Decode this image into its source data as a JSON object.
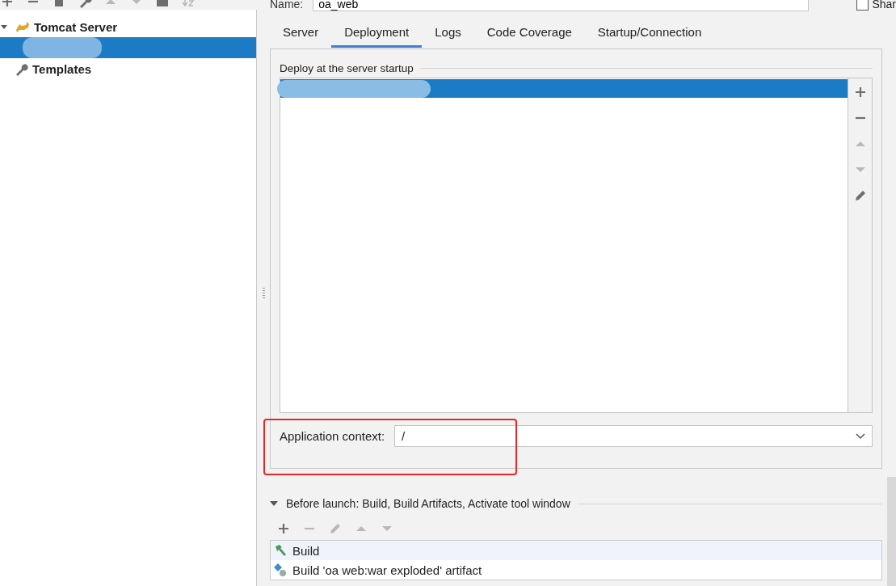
{
  "tree": [
    {
      "kind": "server",
      "label": "Tomcat Server",
      "expanded": true,
      "selected": false,
      "children": [
        {
          "selected": true
        }
      ]
    },
    {
      "kind": "templates",
      "label": "Templates",
      "selected": false
    }
  ],
  "name_field": {
    "label": "Name:",
    "value": "oa_web"
  },
  "share": {
    "label": "Shar",
    "checked": false
  },
  "tabs": [
    {
      "label": "Server",
      "selected": false
    },
    {
      "label": "Deployment",
      "selected": true
    },
    {
      "label": "Logs",
      "selected": false
    },
    {
      "label": "Code Coverage",
      "selected": false
    },
    {
      "label": "Startup/Connection",
      "selected": false
    }
  ],
  "deployment": {
    "title": "Deploy at the server startup",
    "items": [
      {
        "selected": true
      }
    ],
    "tools": [
      {
        "kind": "add",
        "disabled": false
      },
      {
        "kind": "remove",
        "disabled": false
      },
      {
        "kind": "up",
        "disabled": true
      },
      {
        "kind": "down",
        "disabled": true
      },
      {
        "kind": "edit",
        "disabled": false
      }
    ]
  },
  "app_context": {
    "label": "Application context:",
    "value": "/"
  },
  "before_launch": {
    "title": "Before launch: Build, Build Artifacts, Activate tool window",
    "expanded": true,
    "tools": [
      {
        "kind": "add",
        "disabled": false
      },
      {
        "kind": "remove",
        "disabled": true
      },
      {
        "kind": "edit",
        "disabled": true
      },
      {
        "kind": "up",
        "disabled": true
      },
      {
        "kind": "down",
        "disabled": true
      }
    ],
    "tasks": [
      {
        "kind": "build",
        "label": "Build",
        "selected": true
      },
      {
        "kind": "artifact",
        "label": "Build 'oa web:war exploded' artifact",
        "selected": false
      }
    ]
  }
}
